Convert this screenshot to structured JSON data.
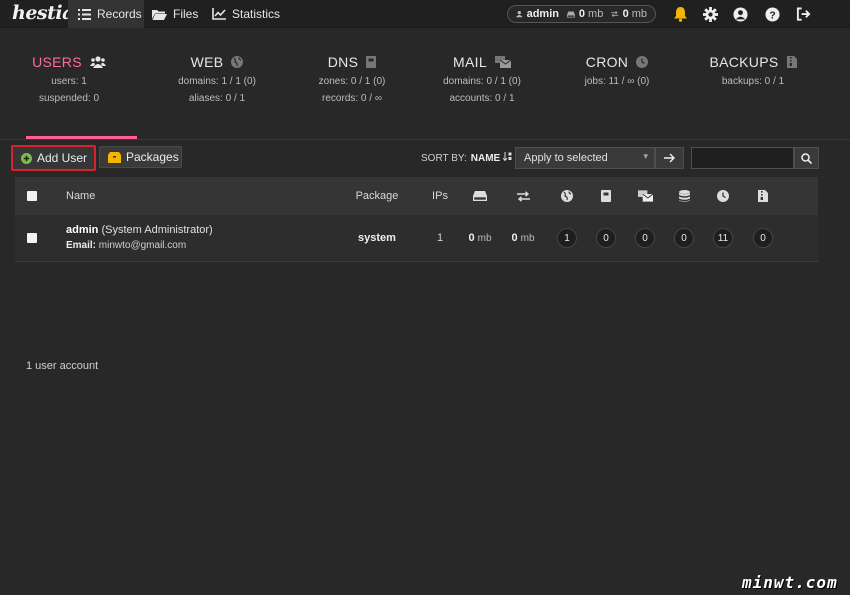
{
  "app": {
    "logo_text": "hestia"
  },
  "nav": [
    {
      "label": "Records",
      "icon": "list-icon"
    },
    {
      "label": "Files",
      "icon": "folder-icon"
    },
    {
      "label": "Statistics",
      "icon": "chart-icon"
    }
  ],
  "usage": {
    "user": "admin",
    "disk_value": "0",
    "disk_unit": "mb",
    "bandwidth_value": "0",
    "bandwidth_unit": "mb"
  },
  "stats": {
    "users": {
      "title": "USERS",
      "line1": "users: 1",
      "line2": "suspended: 0"
    },
    "web": {
      "title": "WEB",
      "line1": "domains: 1 / 1 (0)",
      "line2": "aliases: 0 / 1"
    },
    "dns": {
      "title": "DNS",
      "line1": "zones: 0 / 1 (0)",
      "line2": "records: 0 / ∞"
    },
    "mail": {
      "title": "MAIL",
      "line1": "domains: 0 / 1 (0)",
      "line2": "accounts: 0 / 1"
    },
    "cron": {
      "title": "CRON",
      "line1": "jobs: 11 / ∞ (0)",
      "line2": ""
    },
    "backups": {
      "title": "BACKUPS",
      "line1": "backups: 0 / 1",
      "line2": ""
    }
  },
  "toolbar": {
    "add_user_label": "Add User",
    "packages_label": "Packages",
    "sort_by_label": "SORT BY:",
    "sort_value": "NAME",
    "bulk_action_value": "Apply to selected",
    "search_placeholder": ""
  },
  "table": {
    "headers": {
      "name": "Name",
      "package": "Package",
      "ips": "IPs"
    },
    "rows": [
      {
        "username": "admin",
        "fullname": "(System Administrator)",
        "email_label": "Email:",
        "email": "minwto@gmail.com",
        "package": "system",
        "ips": "1",
        "disk_value": "0",
        "disk_unit": "mb",
        "bandwidth_value": "0",
        "bandwidth_unit": "mb",
        "web_domains": "1",
        "dns_zones": "0",
        "mail_domains": "0",
        "databases": "0",
        "cron_jobs": "11",
        "backups": "0"
      }
    ]
  },
  "footer": {
    "count_text": "1 user account"
  },
  "watermark": "minwt.com",
  "colors": {
    "accent": "#ff5e91",
    "add_user_highlight": "#d9232b",
    "add_icon_green": "#7bc043"
  }
}
